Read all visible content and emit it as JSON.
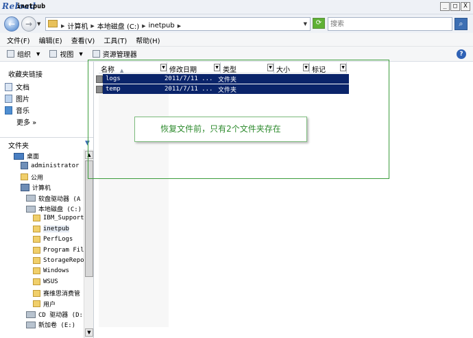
{
  "window": {
    "logo_text": "Reload",
    "title": "inetpub",
    "controls": [
      "_",
      "□",
      "X"
    ]
  },
  "nav": {
    "back_glyph": "←",
    "forward_glyph": "→",
    "breadcrumbs": [
      "计算机",
      "本地磁盘 (C:)",
      "inetpub"
    ],
    "search_placeholder": "搜索"
  },
  "menu": [
    "文件(F)",
    "编辑(E)",
    "查看(V)",
    "工具(T)",
    "帮助(H)"
  ],
  "toolbar": {
    "organize": "组织",
    "views": "视图",
    "explorer": "资源管理器"
  },
  "sidebar": {
    "favorites_title": "收藏夹链接",
    "favorites": [
      "文档",
      "图片",
      "音乐"
    ],
    "more": "更多 »",
    "folders_title": "文件夹",
    "tree": [
      {
        "label": "桌面",
        "type": "desktop"
      },
      {
        "label": "administrator",
        "type": "user"
      },
      {
        "label": "公用",
        "type": "folder"
      },
      {
        "label": "计算机",
        "type": "computer"
      },
      {
        "label": "软盘驱动器 (A",
        "type": "drive"
      },
      {
        "label": "本地磁盘 (C:)",
        "type": "drive"
      },
      {
        "label": "IBM_Support",
        "type": "folder"
      },
      {
        "label": "inetpub",
        "type": "folder",
        "selected": true
      },
      {
        "label": "PerfLogs",
        "type": "folder"
      },
      {
        "label": "Program File",
        "type": "folder"
      },
      {
        "label": "StorageRepo",
        "type": "folder"
      },
      {
        "label": "Windows",
        "type": "folder"
      },
      {
        "label": "WSUS",
        "type": "folder"
      },
      {
        "label": "赛维思消费管",
        "type": "folder"
      },
      {
        "label": "用户",
        "type": "folder"
      },
      {
        "label": "CD 驱动器 (D:",
        "type": "drive"
      },
      {
        "label": "新加卷 (E:)",
        "type": "drive"
      }
    ]
  },
  "columns": [
    "名称",
    "修改日期",
    "类型",
    "大小",
    "标记"
  ],
  "files": [
    {
      "name": "logs",
      "date": "2011/7/11 ...",
      "type": "文件夹"
    },
    {
      "name": "temp",
      "date": "2011/7/11 ...",
      "type": "文件夹"
    }
  ],
  "annotation": {
    "callout_text": "恢复文件前，只有2个文件夹存在",
    "frame_color": "#3b9c3b",
    "text_color": "#2e8b2e"
  },
  "colors": {
    "selection": "#0a246a",
    "accent": "#3d6fb3"
  }
}
